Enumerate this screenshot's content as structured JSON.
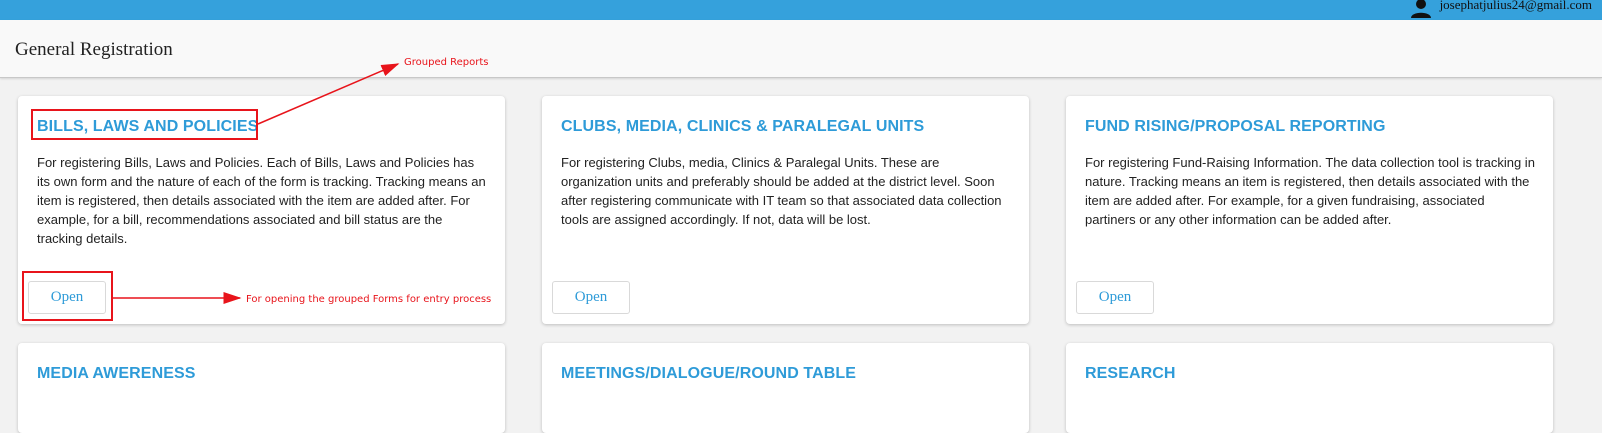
{
  "user": {
    "email": "josephatjulius24@gmail.com"
  },
  "page": {
    "title": "General Registration"
  },
  "cards": [
    {
      "title": "BILLS, LAWS AND POLICIES",
      "description": "For registering Bills, Laws and Policies. Each of Bills, Laws and Policies has its own form and the nature of each of the form is tracking. Tracking means an item is registered, then details associated with the item are added after. For example, for a bill, recommendations associated and bill status are the tracking details.",
      "button_label": "Open"
    },
    {
      "title": "CLUBS, MEDIA, CLINICS & PARALEGAL UNITS",
      "description": "For registering Clubs, media, Clinics & Paralegal Units. These are organization units and preferably should be added at the district level. Soon after registering communicate with IT team so that associated data collection tools are assigned accordingly. If not, data will be lost.",
      "button_label": "Open"
    },
    {
      "title": "FUND RISING/PROPOSAL REPORTING",
      "description": "For registering Fund-Raising Information. The data collection tool is tracking in nature. Tracking means an item is registered, then details associated with the item are added after. For example, for a given fundraising, associated partiners or any other information can be added after.",
      "button_label": "Open"
    },
    {
      "title": "MEDIA AWERENESS"
    },
    {
      "title": "MEETINGS/DIALOGUE/ROUND TABLE"
    },
    {
      "title": "RESEARCH"
    }
  ],
  "annotations": {
    "grouped_reports": "Grouped Reports",
    "open_forms": "For opening the grouped Forms for entry process",
    "color": "#e8141b"
  },
  "colors": {
    "topbar": "#35a1dc",
    "card_title": "#2e9bd8",
    "button_text": "#2e9bd8"
  }
}
